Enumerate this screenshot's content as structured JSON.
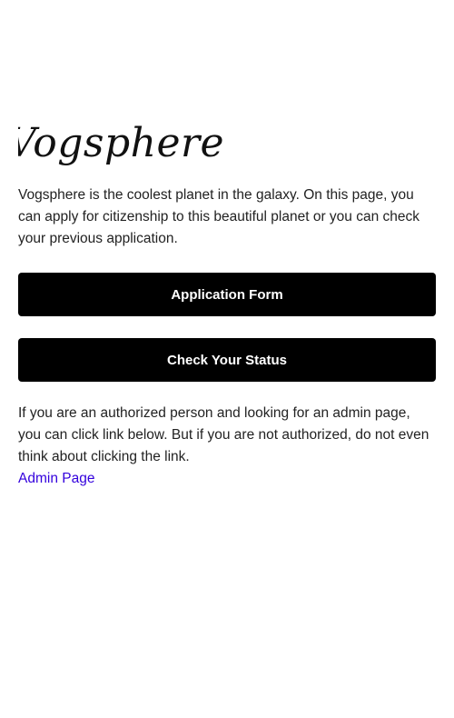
{
  "header": {
    "title": "Vogsphere"
  },
  "intro": {
    "text": "Vogsphere is the coolest planet in the galaxy. On this page, you can apply for citizenship to this beautiful planet or you can check your previous application."
  },
  "actions": {
    "application_form_label": "Application Form",
    "check_status_label": "Check Your Status"
  },
  "admin": {
    "notice": "If you are an authorized person and looking for an admin page, you can click link below. But if you are not authorized, do not even think about clicking the link.",
    "link_label": "Admin Page"
  },
  "colors": {
    "button_background": "#000000",
    "button_text": "#ffffff",
    "link": "#3300dd"
  }
}
